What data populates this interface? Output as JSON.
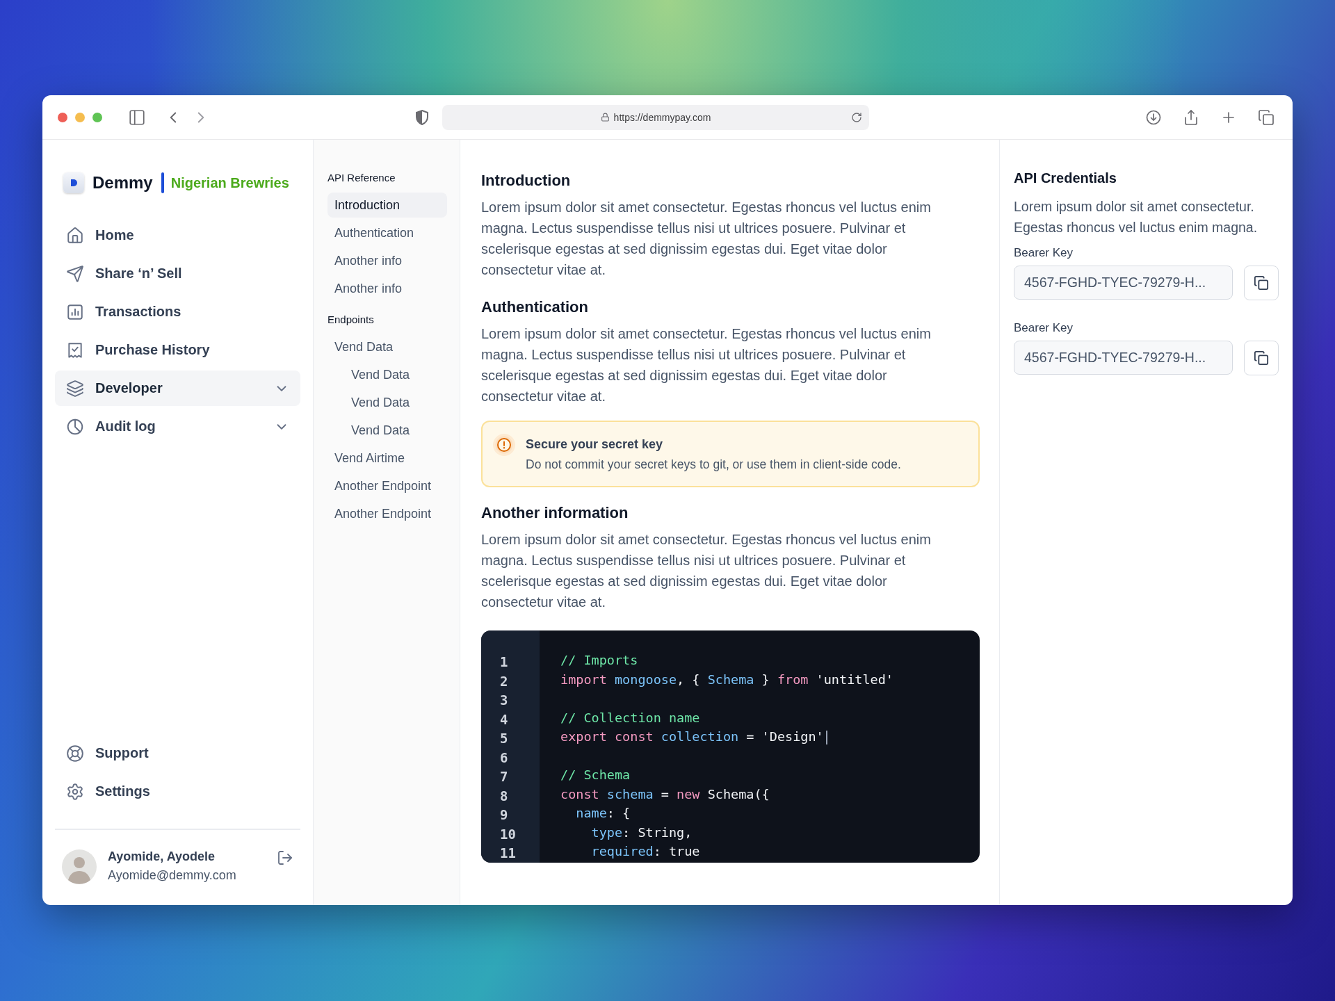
{
  "browser": {
    "url": "https://demmypay.com"
  },
  "sidebar": {
    "brand": "Demmy",
    "workspace": "Nigerian Brewries",
    "nav": [
      {
        "label": "Home",
        "selected": false,
        "has_submenu": false
      },
      {
        "label": "Share ‘n’ Sell",
        "selected": false,
        "has_submenu": false
      },
      {
        "label": "Transactions",
        "selected": false,
        "has_submenu": false
      },
      {
        "label": "Purchase History",
        "selected": false,
        "has_submenu": false
      },
      {
        "label": "Developer",
        "selected": true,
        "has_submenu": true
      },
      {
        "label": "Audit log",
        "selected": false,
        "has_submenu": true
      }
    ],
    "footer_nav": [
      {
        "label": "Support"
      },
      {
        "label": "Settings"
      }
    ],
    "user": {
      "name": "Ayomide, Ayodele",
      "email": "Ayomide@demmy.com"
    }
  },
  "subnav": {
    "sections": [
      {
        "title": "API Reference",
        "items": [
          {
            "label": "Introduction",
            "selected": true
          },
          {
            "label": "Authentication",
            "selected": false
          },
          {
            "label": "Another info",
            "selected": false
          },
          {
            "label": "Another info",
            "selected": false
          }
        ]
      },
      {
        "title": "Endpoints",
        "items": [
          {
            "label": "Vend Data",
            "selected": false,
            "children": [
              {
                "label": "Vend Data",
                "selected": false
              },
              {
                "label": "Vend Data",
                "selected": false
              },
              {
                "label": "Vend Data",
                "selected": false
              }
            ]
          },
          {
            "label": "Vend Airtime",
            "selected": false
          },
          {
            "label": "Another Endpoint",
            "selected": false
          },
          {
            "label": "Another Endpoint",
            "selected": false
          }
        ]
      }
    ]
  },
  "content": {
    "sections": [
      {
        "kind": "text",
        "heading": "Introduction",
        "body": "Lorem ipsum dolor sit amet consectetur. Egestas rhoncus vel luctus enim magna. Lectus suspendisse tellus nisi ut ultrices posuere. Pulvinar et scelerisque egestas at sed dignissim egestas dui. Eget vitae dolor consectetur vitae at."
      },
      {
        "kind": "text",
        "heading": "Authentication",
        "body": "Lorem ipsum dolor sit amet consectetur. Egestas rhoncus vel luctus enim magna. Lectus suspendisse tellus nisi ut ultrices posuere. Pulvinar et scelerisque egestas at sed dignissim egestas dui. Eget vitae dolor consectetur vitae at."
      },
      {
        "kind": "alert",
        "heading": "Secure your secret key",
        "body": "Do not commit your secret keys to git, or use them in client-side code."
      },
      {
        "kind": "text",
        "heading": "Another information",
        "body": "Lorem ipsum dolor sit amet consectetur. Egestas rhoncus vel luctus enim magna. Lectus suspendisse tellus nisi ut ultrices posuere. Pulvinar et scelerisque egestas at sed dignissim egestas dui. Eget vitae dolor consectetur vitae at."
      },
      {
        "kind": "code",
        "lines": [
          {
            "number": "1",
            "cursor": false,
            "tokens": [
              {
                "kind": "comment",
                "text": "// Imports"
              }
            ]
          },
          {
            "number": "2",
            "cursor": false,
            "tokens": [
              {
                "kind": "keyword",
                "text": "import"
              },
              {
                "kind": "ident",
                "text": " mongoose"
              },
              {
                "kind": "plain",
                "text": ", { "
              },
              {
                "kind": "ident",
                "text": "Schema"
              },
              {
                "kind": "plain",
                "text": " } "
              },
              {
                "kind": "keyword",
                "text": "from"
              },
              {
                "kind": "plain",
                "text": " 'untitled'"
              }
            ]
          },
          {
            "number": "3",
            "cursor": false
          },
          {
            "number": "4",
            "cursor": false,
            "tokens": [
              {
                "kind": "comment",
                "text": "// Collection name"
              }
            ]
          },
          {
            "number": "5",
            "cursor": true,
            "tokens": [
              {
                "kind": "keyword",
                "text": "export"
              },
              {
                "kind": "keyword",
                "text": " const"
              },
              {
                "kind": "ident",
                "text": " collection"
              },
              {
                "kind": "plain",
                "text": " = 'Design'"
              }
            ]
          },
          {
            "number": "6",
            "cursor": false
          },
          {
            "number": "7",
            "cursor": false,
            "tokens": [
              {
                "kind": "comment",
                "text": "// Schema"
              }
            ]
          },
          {
            "number": "8",
            "cursor": false,
            "tokens": [
              {
                "kind": "keyword",
                "text": "const"
              },
              {
                "kind": "ident",
                "text": " schema"
              },
              {
                "kind": "plain",
                "text": " = "
              },
              {
                "kind": "keyword",
                "text": "new"
              },
              {
                "kind": "plain",
                "text": " Schema({"
              }
            ]
          },
          {
            "number": "9",
            "cursor": false,
            "tokens": [
              {
                "kind": "ident",
                "text": "  name"
              },
              {
                "kind": "plain",
                "text": ": {"
              }
            ]
          },
          {
            "number": "10",
            "cursor": false,
            "tokens": [
              {
                "kind": "ident",
                "text": "    type"
              },
              {
                "kind": "plain",
                "text": ": String,"
              }
            ]
          },
          {
            "number": "11",
            "cursor": false,
            "tokens": [
              {
                "kind": "ident",
                "text": "    required"
              },
              {
                "kind": "plain",
                "text": ": true"
              }
            ]
          }
        ]
      }
    ]
  },
  "credentials": {
    "title": "API Credentials",
    "description": "Lorem ipsum dolor sit amet consectetur. Egestas rhoncus vel luctus enim magna.",
    "keys": [
      {
        "label": "Bearer Key",
        "value": "4567-FGHD-TYEC-79279-H..."
      },
      {
        "label": "Bearer Key",
        "value": "4567-FGHD-TYEC-79279-H..."
      }
    ]
  }
}
